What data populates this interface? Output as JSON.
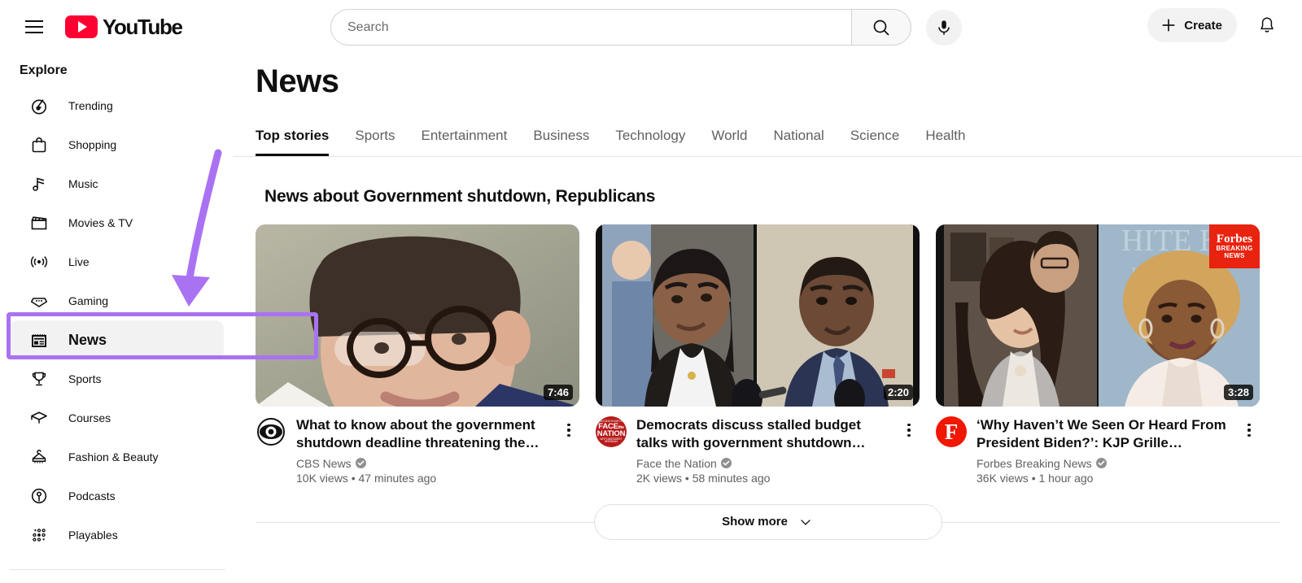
{
  "header": {
    "menu_icon": "hamburger-menu-icon",
    "logo_text": "YouTube",
    "brand_color": "#ff0033",
    "search": {
      "value": "",
      "placeholder": "Search",
      "button_icon": "search-icon"
    },
    "mic_icon": "microphone-icon",
    "create_label": "Create",
    "create_icon": "plus-icon",
    "notifications_icon": "bell-icon"
  },
  "sidebar": {
    "section_label": "Explore",
    "items": [
      {
        "label": "Trending",
        "icon": "trending-flame-icon",
        "active": false
      },
      {
        "label": "Shopping",
        "icon": "shopping-bag-icon",
        "active": false
      },
      {
        "label": "Music",
        "icon": "music-note-icon",
        "active": false
      },
      {
        "label": "Movies & TV",
        "icon": "clapperboard-icon",
        "active": false
      },
      {
        "label": "Live",
        "icon": "live-broadcast-icon",
        "active": false
      },
      {
        "label": "Gaming",
        "icon": "gamepad-icon",
        "active": false
      },
      {
        "label": "News",
        "icon": "newspaper-icon",
        "active": true
      },
      {
        "label": "Sports",
        "icon": "trophy-icon",
        "active": false
      },
      {
        "label": "Courses",
        "icon": "graduation-cap-icon",
        "active": false
      },
      {
        "label": "Fashion & Beauty",
        "icon": "clothes-hanger-icon",
        "active": false
      },
      {
        "label": "Podcasts",
        "icon": "podcast-mic-icon",
        "active": false
      },
      {
        "label": "Playables",
        "icon": "playables-dots-icon",
        "active": false
      }
    ]
  },
  "main": {
    "page_title": "News",
    "tabs": [
      {
        "label": "Top stories",
        "active": true
      },
      {
        "label": "Sports",
        "active": false
      },
      {
        "label": "Entertainment",
        "active": false
      },
      {
        "label": "Business",
        "active": false
      },
      {
        "label": "Technology",
        "active": false
      },
      {
        "label": "World",
        "active": false
      },
      {
        "label": "National",
        "active": false
      },
      {
        "label": "Science",
        "active": false
      },
      {
        "label": "Health",
        "active": false
      }
    ],
    "shelf_title": "News about Government shutdown, Republicans",
    "videos": [
      {
        "title": "What to know about the government shutdown deadline threatening the…",
        "channel": "CBS News",
        "verified": true,
        "stats": "10K views • 47 minutes ago",
        "duration": "7:46",
        "avatar_icon": "cbs-eye-logo",
        "overlay_badge": null
      },
      {
        "title": "Democrats discuss stalled budget talks with government shutdown…",
        "channel": "Face the Nation",
        "verified": true,
        "stats": "2K views • 58 minutes ago",
        "duration": "2:20",
        "avatar_icon": "face-the-nation-logo",
        "overlay_badge": null
      },
      {
        "title": "‘Why Haven’t We Seen Or Heard From President Biden?’: KJP Grille…",
        "channel": "Forbes Breaking News",
        "verified": true,
        "stats": "36K views • 1 hour ago",
        "duration": "3:28",
        "avatar_icon": "forbes-f-logo",
        "overlay_badge": {
          "line1": "Forbes",
          "line2": "BREAKING",
          "line3": "NEWS",
          "color": "#e8230f"
        }
      }
    ],
    "show_more_label": "Show more",
    "show_more_icon": "chevron-down-icon"
  },
  "annotation": {
    "color": "#a972f2",
    "arrow_icon": "curved-arrow-pointing-to-news",
    "highlight_target": "News"
  }
}
